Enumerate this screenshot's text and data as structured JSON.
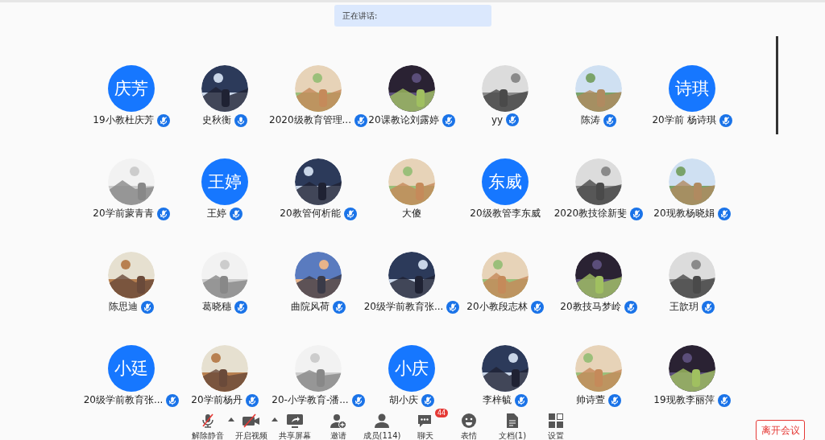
{
  "speaking_banner": {
    "label": "正在讲话:"
  },
  "participants": [
    {
      "name": "19小教杜庆芳",
      "avatar": {
        "kind": "letter",
        "text": "庆芳"
      },
      "mic": {
        "muted": true
      }
    },
    {
      "name": "史秋衡",
      "mic": {
        "muted": false
      }
    },
    {
      "name": "2020级教育管理...",
      "mic": {
        "muted": true
      }
    },
    {
      "name": "20课教论刘露婷",
      "mic": {
        "muted": true
      }
    },
    {
      "name": "yy",
      "mic": {
        "muted": true
      }
    },
    {
      "name": "陈涛",
      "mic": {
        "muted": true
      }
    },
    {
      "name": "20学前 杨诗琪",
      "avatar": {
        "kind": "letter",
        "text": "诗琪"
      },
      "mic": {
        "muted": true
      }
    },
    {
      "name": "20学前蒙青青",
      "mic": {
        "muted": true
      }
    },
    {
      "name": "王婷",
      "avatar": {
        "kind": "letter",
        "text": "王婷"
      },
      "mic": {
        "muted": true
      }
    },
    {
      "name": "20教管何析能",
      "mic": {
        "muted": true
      }
    },
    {
      "name": "大傻"
    },
    {
      "name": "20级教管李东威",
      "avatar": {
        "kind": "letter",
        "text": "东威"
      }
    },
    {
      "name": "2020教技徐新斐",
      "mic": {
        "muted": true
      }
    },
    {
      "name": "20现教杨晓娟",
      "mic": {
        "muted": true
      }
    },
    {
      "name": "陈思迪",
      "mic": {
        "muted": true
      }
    },
    {
      "name": "葛晓穗",
      "mic": {
        "muted": true
      }
    },
    {
      "name": "曲院风荷",
      "mic": {
        "muted": true
      }
    },
    {
      "name": "20级学前教育张...",
      "mic": {
        "muted": true
      }
    },
    {
      "name": "20小教段志林",
      "mic": {
        "muted": true
      }
    },
    {
      "name": "20教技马梦岭",
      "mic": {
        "muted": true
      }
    },
    {
      "name": "王歆玥",
      "mic": {
        "muted": true
      }
    },
    {
      "name": "20级学前教育张...",
      "avatar": {
        "kind": "letter",
        "text": "小廷"
      },
      "mic": {
        "muted": true
      }
    },
    {
      "name": "20学前杨丹",
      "mic": {
        "muted": true
      }
    },
    {
      "name": "20-小学教育-潘...",
      "mic": {
        "muted": true
      }
    },
    {
      "name": "胡小庆",
      "avatar": {
        "kind": "letter",
        "text": "小庆"
      },
      "mic": {
        "muted": true
      }
    },
    {
      "name": "李梓毓",
      "mic": {
        "muted": true
      }
    },
    {
      "name": "帅诗萱",
      "mic": {
        "muted": true
      }
    },
    {
      "name": "19现教李丽萍",
      "mic": {
        "muted": true
      }
    }
  ],
  "toolbar": [
    {
      "kind": "mic",
      "label": "解除静音",
      "caret": true
    },
    {
      "kind": "video",
      "label": "开启视频",
      "caret": true
    },
    {
      "kind": "share",
      "label": "共享屏幕",
      "caret": false
    },
    {
      "kind": "invite",
      "label": "邀请",
      "caret": false
    },
    {
      "kind": "members",
      "label": "成员(114)",
      "caret": false
    },
    {
      "kind": "chat",
      "label": "聊天",
      "caret": false,
      "badge": "44"
    },
    {
      "kind": "emoji",
      "label": "表情",
      "caret": false
    },
    {
      "kind": "document",
      "label": "文档(1)",
      "caret": false
    },
    {
      "kind": "settings",
      "label": "设置",
      "caret": false
    }
  ],
  "leave_button": {
    "label": "离开会议"
  }
}
